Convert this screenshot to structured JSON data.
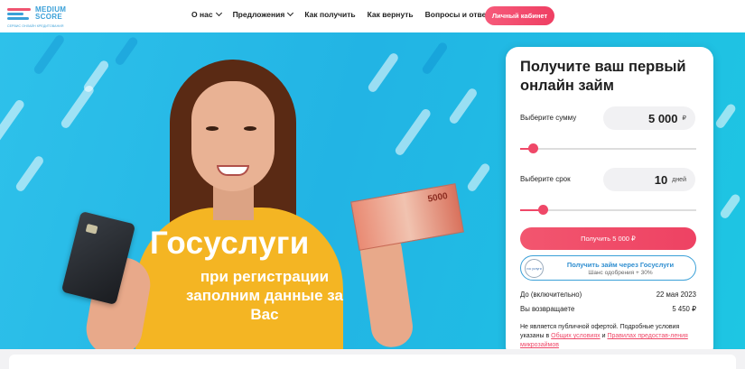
{
  "logo": {
    "line1": "MEDIUM",
    "line2": "SCORE",
    "tagline": "СЕРВИС ОНЛАЙН КРЕДИТОВАНИЯ"
  },
  "nav": [
    {
      "label": "О нас",
      "has_dropdown": true
    },
    {
      "label": "Предложения",
      "has_dropdown": true
    },
    {
      "label": "Как получить",
      "has_dropdown": false
    },
    {
      "label": "Как вернуть",
      "has_dropdown": false
    },
    {
      "label": "Вопросы и ответы",
      "has_dropdown": false
    }
  ],
  "cabinet_button": "Личный кабинет",
  "promo": {
    "title": "Госуслуги",
    "subtitle": "при регистрации заполним данные за Вас"
  },
  "banknote": {
    "value": "5000"
  },
  "form": {
    "title": "Получите ваш первый онлайн займ",
    "amount_label": "Выберите сумму",
    "amount_value": "5 000",
    "amount_unit": "₽",
    "amount_slider_fraction": 0.07,
    "term_label": "Выберите срок",
    "term_value": "10",
    "term_unit": "дней",
    "term_slider_fraction": 0.13,
    "submit_label": "Получить 5 000 ₽",
    "gosuslugi": {
      "icon_text": "гос услуги",
      "title": "Получить займ через Госуслуги",
      "subtitle": "Шанс одобрения + 30%"
    },
    "due_label": "До (включительно)",
    "due_value": "22 мая 2023",
    "return_label": "Вы возвращаете",
    "return_value": "5 450 ₽",
    "note_prefix": "Не является публичной офертой. Подробные условия указаны в",
    "note_link1": "Общих условиях",
    "note_and": "и",
    "note_link2": "Правилах предостав-ления микрозаймов"
  },
  "colors": {
    "accent": "#ef4868",
    "hero_blue": "#22b4e4",
    "link_blue": "#2f8ed0"
  }
}
